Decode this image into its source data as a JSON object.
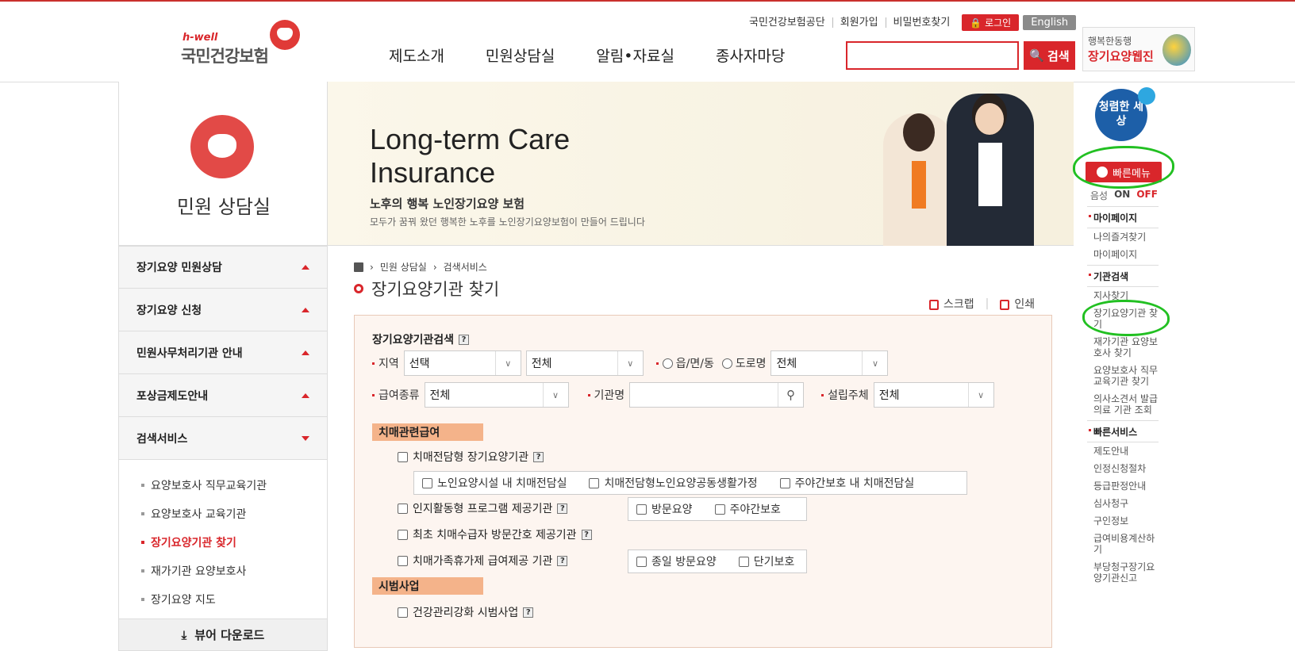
{
  "header": {
    "logo_sub": "h-well",
    "logo_name": "국민건강보험",
    "util": [
      "국민건강보험공단",
      "회원가입",
      "비밀번호찾기"
    ],
    "login": "로그인",
    "english": "English",
    "gnb": [
      "제도소개",
      "민원상담실",
      "알림•자료실",
      "종사자마당"
    ],
    "search_placeholder": "",
    "search_btn": "검색",
    "banner_line1": "행복한동행",
    "banner_line2": "장기요양웹진"
  },
  "lnb": {
    "title": "민원 상담실",
    "items": [
      "장기요양 민원상담",
      "장기요양 신청",
      "민원사무처리기관 안내",
      "포상금제도안내",
      "검색서비스"
    ],
    "sub": [
      "요양보호사 직무교육기관",
      "요양보호사 교육기관",
      "장기요양기관 찾기",
      "재가기관 요양보호사",
      "장기요양 지도"
    ],
    "download": "뷰어 다운로드"
  },
  "visual": {
    "title_line1": "Long-term Care",
    "title_line2": "Insurance",
    "sub1": "노후의 행복 노인장기요양 보험",
    "sub2": "모두가 꿈꿔 왔던 행복한 노후를 노인장기요양보험이 만들어 드립니다"
  },
  "content": {
    "crumb": [
      "민원 상담실",
      "검색서비스"
    ],
    "page_title": "장기요양기관 찾기",
    "scrap": "스크랩",
    "print": "인쇄",
    "box_title": "장기요양기관검색",
    "region_label": "지역",
    "region_sel1": "선택",
    "region_sel2": "전체",
    "radio1": "읍/면/동",
    "radio2": "도로명",
    "region_sel3": "전체",
    "benefit_label": "급여종류",
    "benefit_sel": "전체",
    "org_label": "기관명",
    "founder_label": "설립주체",
    "founder_sel": "전체",
    "sect1": "치매관련급여",
    "cb1": "치매전담형 장기요양기관",
    "cb1_sub": [
      "노인요양시설 내 치매전담실",
      "치매전담형노인요양공동생활가정",
      "주야간보호 내 치매전담실"
    ],
    "cb2": "인지활동형 프로그램 제공기관",
    "cb2_sub": [
      "방문요양",
      "주야간보호"
    ],
    "cb3": "최초 치매수급자 방문간호 제공기관",
    "cb4": "치매가족휴가제 급여제공 기관",
    "cb4_sub": [
      "종일 방문요양",
      "단기보호"
    ],
    "sect2": "시범사업",
    "cb5": "건강관리강화 시범사업"
  },
  "quick": {
    "logo": "청렴한 세상",
    "btn": "빠른메뉴",
    "sound": "음성",
    "on": "ON",
    "off": "OFF",
    "mypage_h": "마이페이지",
    "mypage": [
      "나의즐겨찾기",
      "마이페이지"
    ],
    "org_h": "기관검색",
    "org": [
      "지사찾기",
      "장기요양기관 찾기",
      "재가기관 요양보호사 찾기",
      "요양보호사 직무교육기관 찾기",
      "의사소견서 발급 의료 기관 조회"
    ],
    "fast_h": "빠른서비스",
    "fast": [
      "제도안내",
      "인정신청절차",
      "등급판정안내",
      "심사청구",
      "구인정보",
      "급여비용계산하기",
      "부당청구장기요양기관신고"
    ]
  }
}
